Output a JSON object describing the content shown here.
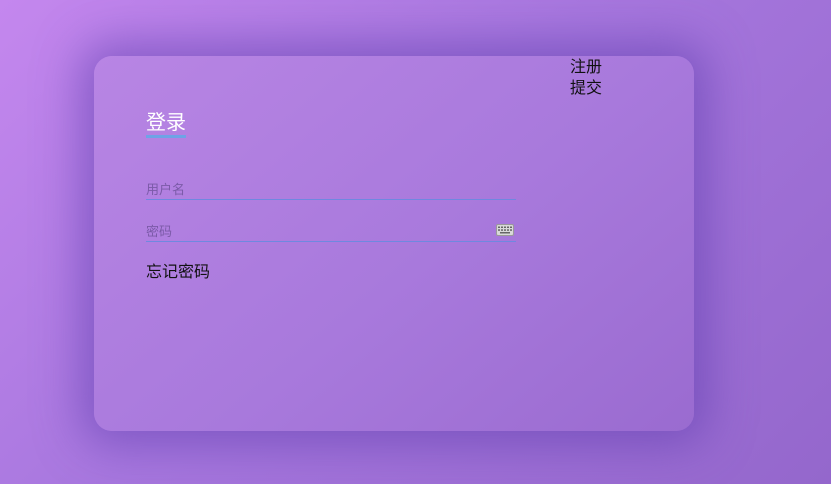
{
  "header_links": {
    "register_label": "注册",
    "submit_label": "提交"
  },
  "login_form": {
    "title": "登录",
    "username_placeholder": "用户名",
    "password_placeholder": "密码",
    "forgot_password_label": "忘记密码"
  },
  "icons": {
    "password_field_icon": "keyboard-icon"
  },
  "colors": {
    "background_gradient_start": "#c487ee",
    "background_gradient_end": "#9467cc",
    "card_shadow": "#5f3eaf",
    "title_underline": "#6ea3e6",
    "input_underline": "#6f88e0"
  }
}
